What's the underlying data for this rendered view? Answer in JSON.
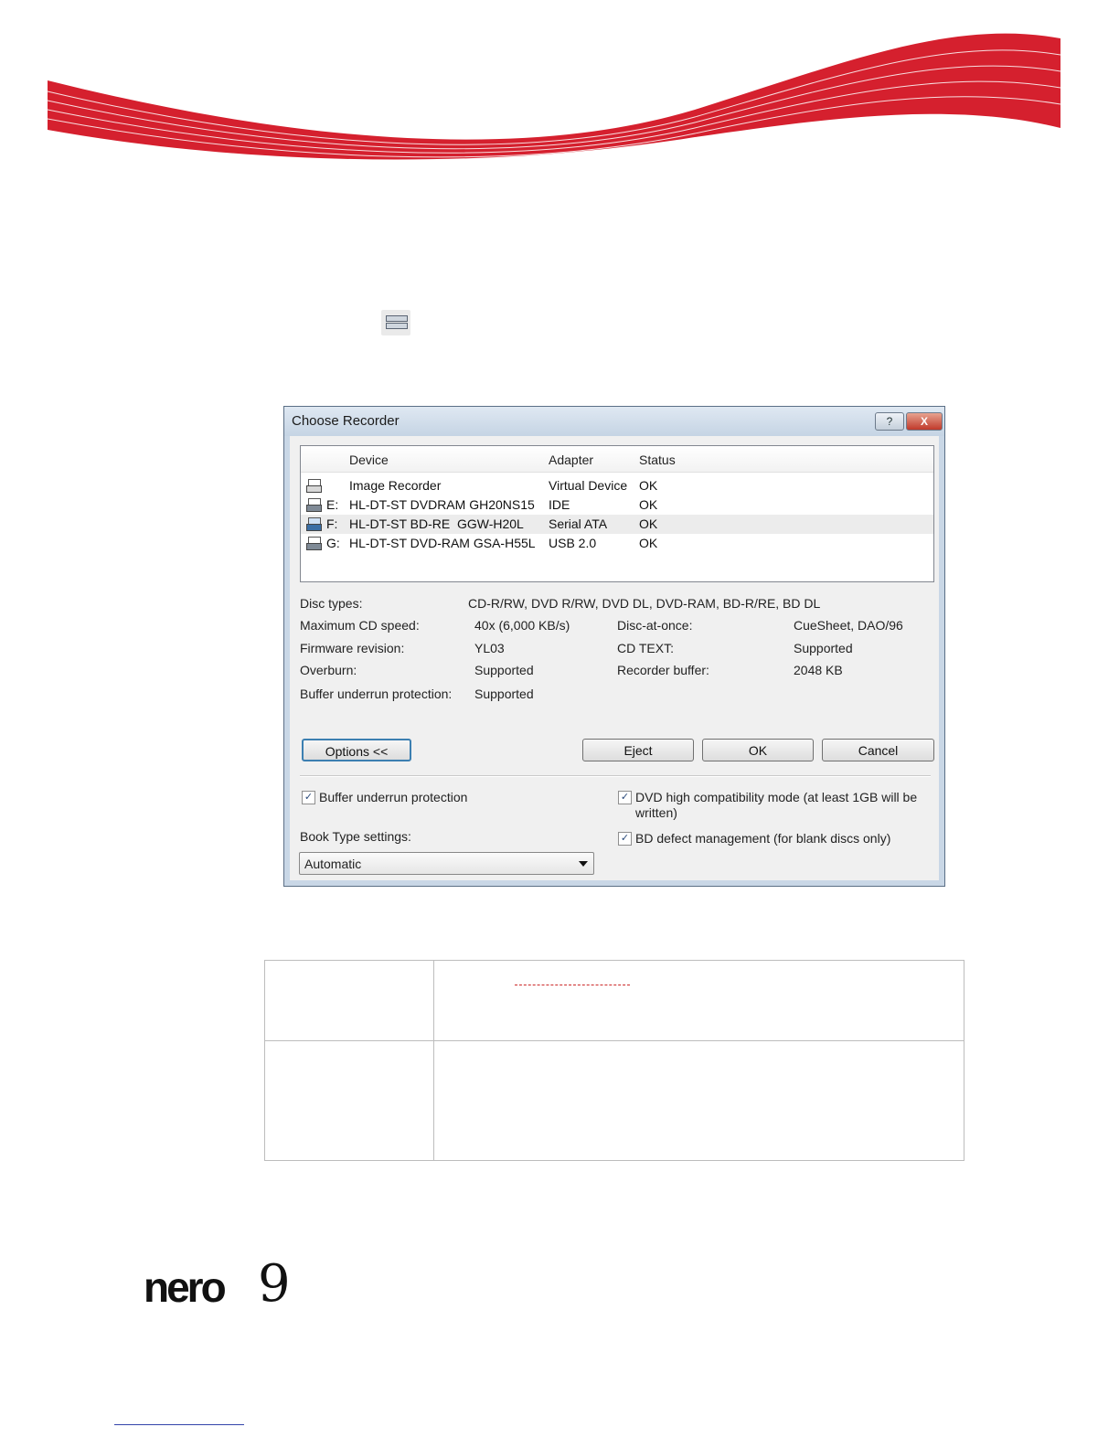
{
  "colors": {
    "swoosh": "#d5202e",
    "dialog_frame": "#c9d7e6",
    "selected_row": "#ececec",
    "footer_link": "#3344aa"
  },
  "toolbar_icon": "choose-recorder-icon",
  "dialog": {
    "title": "Choose Recorder",
    "help_label": "?",
    "close_label": "X",
    "columns": {
      "device": "Device",
      "adapter": "Adapter",
      "status": "Status"
    },
    "rows": [
      {
        "drive": "",
        "device": "Image Recorder",
        "adapter": "Virtual Device",
        "status": "OK"
      },
      {
        "drive": "E:",
        "device": "HL-DT-ST DVDRAM GH20NS15",
        "adapter": "IDE",
        "status": "OK"
      },
      {
        "drive": "F:",
        "device": "HL-DT-ST BD-RE  GGW-H20L",
        "adapter": "Serial ATA",
        "status": "OK"
      },
      {
        "drive": "G:",
        "device": "HL-DT-ST DVD-RAM GSA-H55L",
        "adapter": "USB 2.0",
        "status": "OK"
      }
    ],
    "details": {
      "disc_types_label": "Disc types:",
      "disc_types_value": "CD-R/RW, DVD R/RW, DVD DL, DVD-RAM, BD-R/RE, BD DL",
      "max_speed_label": "Maximum CD speed:",
      "max_speed_value": "40x (6,000 KB/s)",
      "dao_label": "Disc-at-once:",
      "dao_value": "CueSheet, DAO/96",
      "firmware_label": "Firmware revision:",
      "firmware_value": "YL03",
      "cdtext_label": "CD TEXT:",
      "cdtext_value": "Supported",
      "overburn_label": "Overburn:",
      "overburn_value": "Supported",
      "buffer_label": "Recorder buffer:",
      "buffer_value": "2048 KB",
      "bup_label": "Buffer underrun protection:",
      "bup_value": "Supported"
    },
    "buttons": {
      "options": "Options <<",
      "eject": "Eject",
      "ok": "OK",
      "cancel": "Cancel"
    },
    "options": {
      "buffer_underrun": "Buffer underrun protection",
      "dvd_compat": "DVD high compatibility mode (at least 1GB will be",
      "dvd_compat_2": "written)",
      "book_type_label": "Book Type settings:",
      "book_type_value": "Automatic",
      "bd_defect": "BD defect management (for blank discs only)"
    }
  },
  "footer": {
    "logo": "nero",
    "logo_version": "9"
  }
}
